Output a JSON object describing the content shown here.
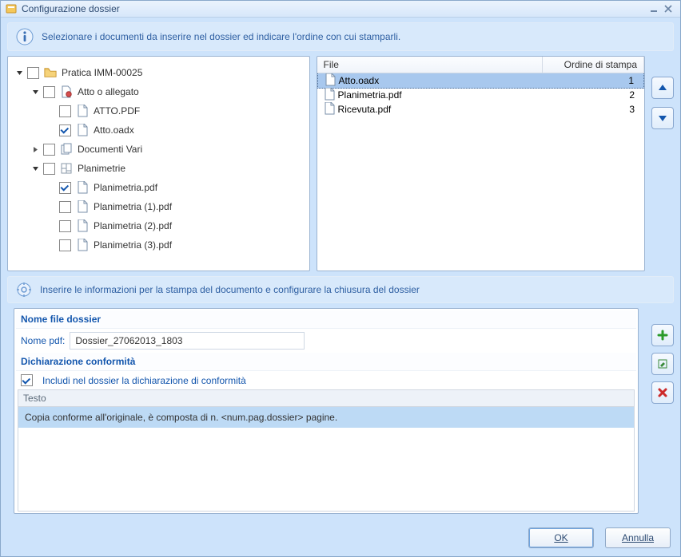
{
  "window": {
    "title": "Configurazione dossier"
  },
  "hints": {
    "top": "Selezionare i documenti da inserire nel dossier ed indicare l'ordine con cui stamparli.",
    "mid": "Inserire le informazioni per la stampa del documento e configurare la chiusura del dossier"
  },
  "tree": {
    "root": {
      "label": "Pratica IMM-00025",
      "checked": false,
      "children": [
        {
          "label": "Atto o allegato",
          "checked": false,
          "children": [
            {
              "label": "ATTO.PDF",
              "checked": false
            },
            {
              "label": "Atto.oadx",
              "checked": true
            }
          ]
        },
        {
          "label": "Documenti Vari",
          "checked": false,
          "collapsed": true,
          "children": []
        },
        {
          "label": "Planimetrie",
          "checked": false,
          "children": [
            {
              "label": "Planimetria.pdf",
              "checked": true
            },
            {
              "label": "Planimetria (1).pdf",
              "checked": false
            },
            {
              "label": "Planimetria (2).pdf",
              "checked": false
            },
            {
              "label": "Planimetria (3).pdf",
              "checked": false
            }
          ]
        }
      ]
    }
  },
  "list": {
    "headers": {
      "file": "File",
      "order": "Ordine di stampa"
    },
    "rows": [
      {
        "file": "Atto.oadx",
        "order": "1",
        "selected": true
      },
      {
        "file": "Planimetria.pdf",
        "order": "2",
        "selected": false
      },
      {
        "file": "Ricevuta.pdf",
        "order": "3",
        "selected": false
      }
    ]
  },
  "config": {
    "section_name_title": "Nome  file  dossier",
    "name_label": "Nome pdf:",
    "name_value": "Dossier_27062013_1803",
    "decl_title": "Dichiarazione  conformità",
    "decl_check_label": "Includi nel dossier la dichiarazione di conformità",
    "decl_checked": true,
    "testo_header": "Testo",
    "testo_items": [
      "Copia conforme all'originale, è composta di n.  <num.pag.dossier>  pagine."
    ]
  },
  "buttons": {
    "ok": "OK",
    "cancel": "Annulla"
  }
}
